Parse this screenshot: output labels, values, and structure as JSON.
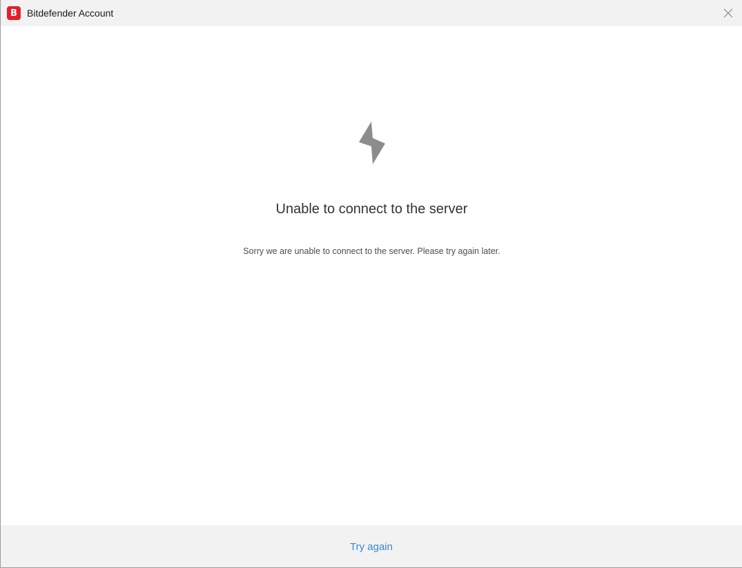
{
  "window": {
    "logo_letter": "B",
    "title": "Bitdefender Account",
    "close_icon": "close-icon",
    "brand_color": "#e2202a"
  },
  "error": {
    "icon": "lightning-bolt-icon",
    "heading": "Unable to connect to the server",
    "message": "Sorry we are unable to connect to the server. Please try again later."
  },
  "footer": {
    "try_again_label": "Try again",
    "link_color": "#3b87d8"
  }
}
